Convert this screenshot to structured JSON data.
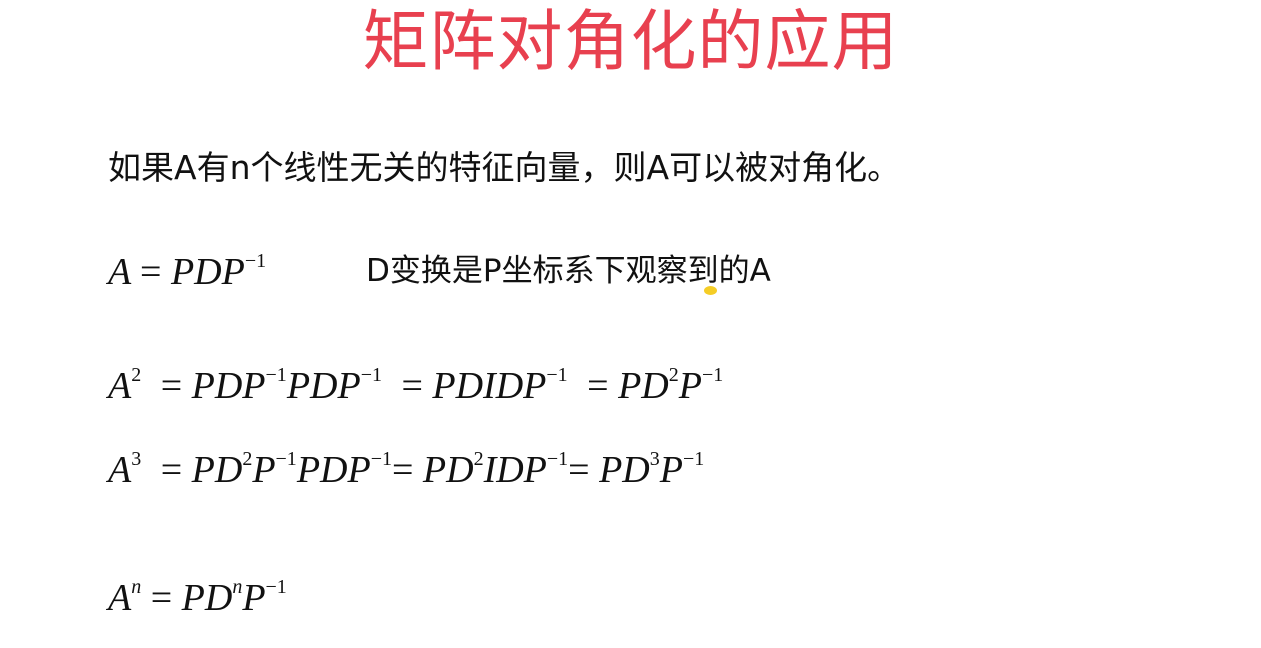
{
  "slide": {
    "title": "矩阵对角化的应用",
    "statement": "如果A有n个线性无关的特征向量，则A可以被对角化。",
    "definition": {
      "lhs": "A",
      "rhs": "PDP",
      "rhs_exp": "−1",
      "note": "D变换是P坐标系下观察到的A"
    },
    "square": {
      "lhs": "A",
      "lhs_exp": "2",
      "t1": "PDP",
      "t1_exp": "−1",
      "t2": "PDP",
      "t2_exp": "−1",
      "t3": "PDIDP",
      "t3_exp": "−1",
      "t4a": "PD",
      "t4a_exp": "2",
      "t4b": "P",
      "t4b_exp": "−1"
    },
    "cube": {
      "lhs": "A",
      "lhs_exp": "3",
      "t1a": "PD",
      "t1a_exp": "2",
      "t1b": "P",
      "t1b_exp": "−1",
      "t1c": "PDP",
      "t1c_exp": "−1",
      "t2a": "PD",
      "t2a_exp": "2",
      "t2b": "IDP",
      "t2b_exp": "−1",
      "t3a": "PD",
      "t3a_exp": "3",
      "t3b": "P",
      "t3b_exp": "−1"
    },
    "power_n": {
      "lhs": "A",
      "lhs_exp": "n",
      "t1a": "PD",
      "t1a_exp": "n",
      "t1b": "P",
      "t1b_exp": "−1"
    },
    "equals": "=",
    "colors": {
      "title": "#e8404f",
      "text": "#111111",
      "cursor_highlight": "#f3c400"
    }
  }
}
